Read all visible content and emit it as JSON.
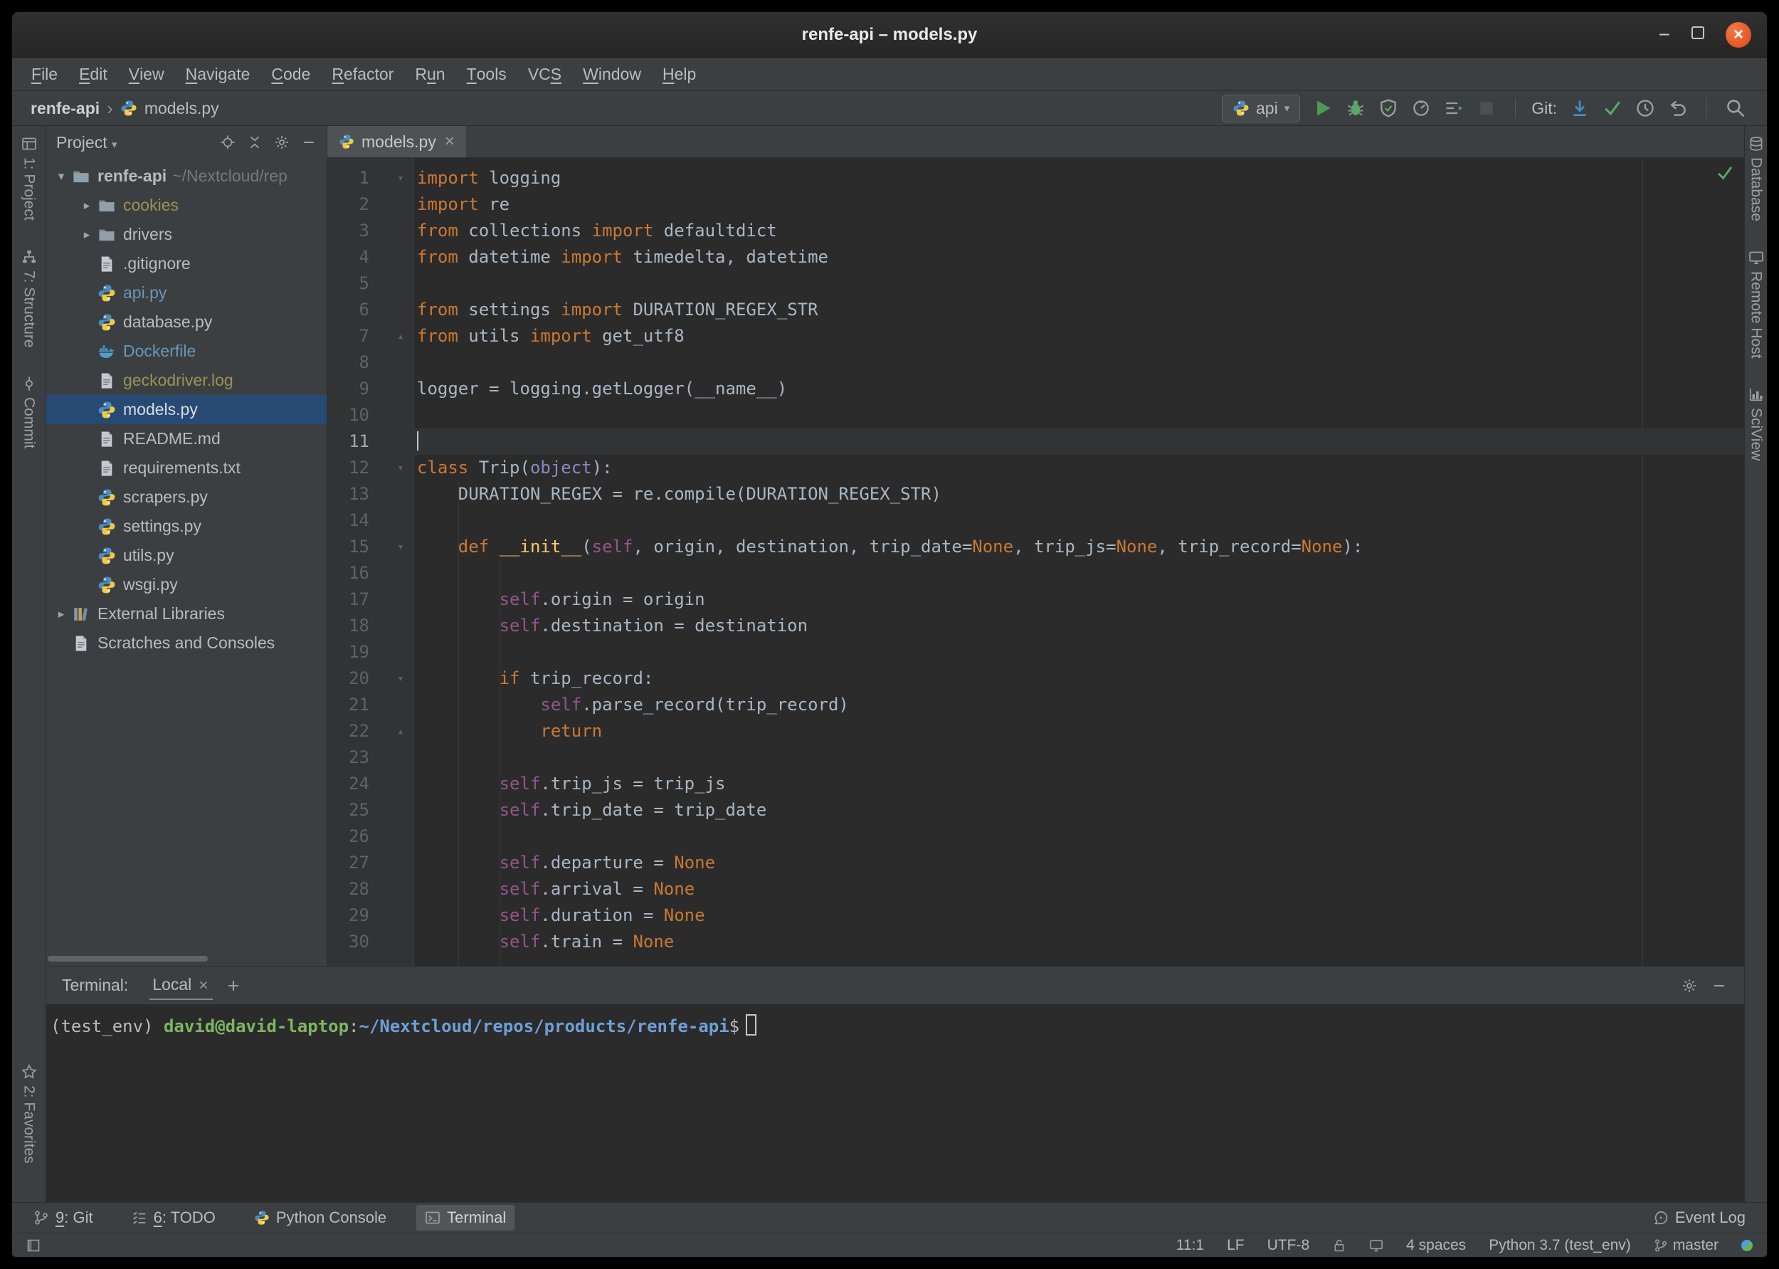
{
  "titlebar": {
    "title": "renfe-api – models.py"
  },
  "menubar": {
    "items": [
      {
        "label": "File",
        "mnemonic": 0
      },
      {
        "label": "Edit",
        "mnemonic": 0
      },
      {
        "label": "View",
        "mnemonic": 0
      },
      {
        "label": "Navigate",
        "mnemonic": 0
      },
      {
        "label": "Code",
        "mnemonic": 0
      },
      {
        "label": "Refactor",
        "mnemonic": 0
      },
      {
        "label": "Run",
        "mnemonic": 1
      },
      {
        "label": "Tools",
        "mnemonic": 0
      },
      {
        "label": "VCS",
        "mnemonic": 2
      },
      {
        "label": "Window",
        "mnemonic": 0
      },
      {
        "label": "Help",
        "mnemonic": 0
      }
    ]
  },
  "navbar": {
    "breadcrumbs": [
      {
        "label": "renfe-api",
        "bold": true
      },
      {
        "label": "models.py",
        "icon": "python"
      }
    ],
    "run_config": {
      "label": "api"
    },
    "run_buttons": [
      {
        "name": "run",
        "icon": "play"
      },
      {
        "name": "debug",
        "icon": "bug"
      },
      {
        "name": "run-with-coverage",
        "icon": "shield"
      },
      {
        "name": "profile",
        "icon": "profiler"
      },
      {
        "name": "concurrency-diagram",
        "icon": "concurrency"
      },
      {
        "name": "stop",
        "icon": "stop",
        "disabled": true
      }
    ],
    "git": {
      "label": "Git:",
      "buttons": [
        {
          "name": "update-project",
          "icon": "arrow-down"
        },
        {
          "name": "commit",
          "icon": "check"
        },
        {
          "name": "history",
          "icon": "clock"
        },
        {
          "name": "rollback",
          "icon": "undo"
        }
      ]
    }
  },
  "stripes": {
    "left_top": [
      {
        "label": "1: Project",
        "icon": "project"
      },
      {
        "label": "7: Structure",
        "icon": "structure"
      },
      {
        "label": "Commit",
        "icon": "commitnode"
      }
    ],
    "left_bottom": [
      {
        "label": "2: Favor<u></u>ites",
        "icon": "star",
        "plain": "2: Favorites"
      }
    ],
    "right": [
      {
        "label": "Database",
        "icon": "database"
      },
      {
        "label": "Remote Host",
        "icon": "remote"
      },
      {
        "label": "SciView",
        "icon": "sciview"
      }
    ]
  },
  "project_panel": {
    "header": "Project",
    "tree": [
      {
        "label": "renfe-api",
        "suffix": "~/Nextcloud/rep",
        "icon": "folder",
        "indent": 0,
        "chevron": "down",
        "bold": true
      },
      {
        "label": "cookies",
        "icon": "folder",
        "indent": 1,
        "chevron": "right",
        "color": "ignored"
      },
      {
        "label": "drivers",
        "icon": "folder",
        "indent": 1,
        "chevron": "right"
      },
      {
        "label": ".gitignore",
        "icon": "file",
        "indent": 1
      },
      {
        "label": "api.py",
        "icon": "python",
        "indent": 1,
        "color": "modified"
      },
      {
        "label": "database.py",
        "icon": "python",
        "indent": 1
      },
      {
        "label": "Dockerfile",
        "icon": "docker",
        "indent": 1,
        "color": "modified"
      },
      {
        "label": "geckodriver.log",
        "icon": "log",
        "indent": 1,
        "color": "ignored"
      },
      {
        "label": "models.py",
        "icon": "python",
        "indent": 1,
        "selected": true
      },
      {
        "label": "README.md",
        "icon": "markdown",
        "indent": 1
      },
      {
        "label": "requirements.txt",
        "icon": "text",
        "indent": 1
      },
      {
        "label": "scrapers.py",
        "icon": "python",
        "indent": 1
      },
      {
        "label": "settings.py",
        "icon": "python",
        "indent": 1
      },
      {
        "label": "utils.py",
        "icon": "python",
        "indent": 1
      },
      {
        "label": "wsgi.py",
        "icon": "python",
        "indent": 1
      },
      {
        "label": "External Libraries",
        "icon": "libraries",
        "indent": 0,
        "chevron": "right"
      },
      {
        "label": "Scratches and Consoles",
        "icon": "scratches",
        "indent": 0
      }
    ],
    "colors": {
      "ignored": "#9c9154",
      "modified": "#6897bb",
      "default": "#bbbbbb",
      "suffix": "#787878",
      "selected_bg": "#274a75",
      "selected_text": "#d8dde2"
    }
  },
  "editor": {
    "tab": {
      "label": "models.py"
    },
    "colors": {
      "kw": "#cc7832",
      "self": "#94558d",
      "fn": "#ffc66d",
      "bi": "#8888c6",
      "d": "#a9b7c6"
    },
    "lines": [
      {
        "n": 1,
        "fold": "down",
        "seg": [
          [
            "import",
            "kw"
          ],
          [
            " logging",
            "d"
          ]
        ]
      },
      {
        "n": 2,
        "seg": [
          [
            "import",
            "kw"
          ],
          [
            " re",
            "d"
          ]
        ]
      },
      {
        "n": 3,
        "seg": [
          [
            "from",
            "kw"
          ],
          [
            " collections ",
            "d"
          ],
          [
            "import",
            "kw"
          ],
          [
            " defaultdict",
            "d"
          ]
        ]
      },
      {
        "n": 4,
        "seg": [
          [
            "from",
            "kw"
          ],
          [
            " datetime ",
            "d"
          ],
          [
            "import",
            "kw"
          ],
          [
            " timedelta, datetime",
            "d"
          ]
        ]
      },
      {
        "n": 5,
        "seg": []
      },
      {
        "n": 6,
        "seg": [
          [
            "from",
            "kw"
          ],
          [
            " settings ",
            "d"
          ],
          [
            "import",
            "kw"
          ],
          [
            " DURATION_REGEX_STR",
            "d"
          ]
        ]
      },
      {
        "n": 7,
        "fold": "up",
        "seg": [
          [
            "from",
            "kw"
          ],
          [
            " utils ",
            "d"
          ],
          [
            "import",
            "kw"
          ],
          [
            " get_utf8",
            "d"
          ]
        ]
      },
      {
        "n": 8,
        "seg": []
      },
      {
        "n": 9,
        "seg": [
          [
            "logger = logging.getLogger(__name__)",
            "d"
          ]
        ]
      },
      {
        "n": 10,
        "seg": []
      },
      {
        "n": 11,
        "current": true,
        "seg": []
      },
      {
        "n": 12,
        "fold": "down",
        "seg": [
          [
            "class",
            "kw"
          ],
          [
            " Trip(",
            "d"
          ],
          [
            "object",
            "bi"
          ],
          [
            "):",
            "d"
          ]
        ]
      },
      {
        "n": 13,
        "seg": [
          [
            "    DURATION_REGEX = re.compile(DURATION_REGEX_STR)",
            "d"
          ]
        ]
      },
      {
        "n": 14,
        "seg": []
      },
      {
        "n": 15,
        "fold": "down",
        "seg": [
          [
            "    ",
            "d"
          ],
          [
            "def",
            "kw"
          ],
          [
            " ",
            "d"
          ],
          [
            "__init__",
            "fn"
          ],
          [
            "(",
            "d"
          ],
          [
            "self",
            "self"
          ],
          [
            ", origin, destination, trip_date=",
            "d"
          ],
          [
            "None",
            "kw"
          ],
          [
            ", trip_js=",
            "d"
          ],
          [
            "None",
            "kw"
          ],
          [
            ", trip_record=",
            "d"
          ],
          [
            "None",
            "kw"
          ],
          [
            "):",
            "d"
          ]
        ]
      },
      {
        "n": 16,
        "seg": []
      },
      {
        "n": 17,
        "seg": [
          [
            "        ",
            "d"
          ],
          [
            "self",
            "self"
          ],
          [
            ".origin = origin",
            "d"
          ]
        ]
      },
      {
        "n": 18,
        "seg": [
          [
            "        ",
            "d"
          ],
          [
            "self",
            "self"
          ],
          [
            ".destination = destination",
            "d"
          ]
        ]
      },
      {
        "n": 19,
        "seg": []
      },
      {
        "n": 20,
        "fold": "down",
        "seg": [
          [
            "        ",
            "d"
          ],
          [
            "if",
            "kw"
          ],
          [
            " trip_record:",
            "d"
          ]
        ]
      },
      {
        "n": 21,
        "seg": [
          [
            "            ",
            "d"
          ],
          [
            "self",
            "self"
          ],
          [
            ".parse_record(trip_record)",
            "d"
          ]
        ]
      },
      {
        "n": 22,
        "fold": "up",
        "seg": [
          [
            "            ",
            "d"
          ],
          [
            "return",
            "kw"
          ]
        ]
      },
      {
        "n": 23,
        "seg": []
      },
      {
        "n": 24,
        "seg": [
          [
            "        ",
            "d"
          ],
          [
            "self",
            "self"
          ],
          [
            ".trip_js = trip_js",
            "d"
          ]
        ]
      },
      {
        "n": 25,
        "seg": [
          [
            "        ",
            "d"
          ],
          [
            "self",
            "self"
          ],
          [
            ".trip_date = trip_date",
            "d"
          ]
        ]
      },
      {
        "n": 26,
        "seg": []
      },
      {
        "n": 27,
        "seg": [
          [
            "        ",
            "d"
          ],
          [
            "self",
            "self"
          ],
          [
            ".departure = ",
            "d"
          ],
          [
            "None",
            "kw"
          ]
        ]
      },
      {
        "n": 28,
        "seg": [
          [
            "        ",
            "d"
          ],
          [
            "self",
            "self"
          ],
          [
            ".arrival = ",
            "d"
          ],
          [
            "None",
            "kw"
          ]
        ]
      },
      {
        "n": 29,
        "seg": [
          [
            "        ",
            "d"
          ],
          [
            "self",
            "self"
          ],
          [
            ".duration = ",
            "d"
          ],
          [
            "None",
            "kw"
          ]
        ]
      },
      {
        "n": 30,
        "seg": [
          [
            "        ",
            "d"
          ],
          [
            "self",
            "self"
          ],
          [
            ".train = ",
            "d"
          ],
          [
            "None",
            "kw"
          ]
        ]
      }
    ]
  },
  "terminal": {
    "label": "Terminal:",
    "tab": {
      "label": "Local"
    },
    "prompt": [
      [
        "(test_env) ",
        "d"
      ],
      [
        "david@david-laptop",
        "user"
      ],
      [
        ":",
        "d"
      ],
      [
        "~/Nextcloud/repos/products/renfe-api",
        "path"
      ],
      [
        "$",
        "d"
      ]
    ],
    "colors": {
      "d": "#bbbbbb",
      "user": "#7cb662",
      "path": "#6f9fd8"
    }
  },
  "bottom_bar": {
    "buttons": [
      {
        "label": "9: Git",
        "icon": "branch",
        "mnemonic": 0
      },
      {
        "label": "6: TODO",
        "icon": "todo",
        "mnemonic": 0
      },
      {
        "label": "Python Console",
        "icon": "python"
      },
      {
        "label": "Terminal",
        "icon": "terminal",
        "active": true
      }
    ],
    "event_log": "Event Log"
  },
  "statusbar": {
    "caret": "11:1",
    "line_separator": "LF",
    "encoding": "UTF-8",
    "indent": "4 spaces",
    "interpreter": "Python 3.7 (test_env)",
    "branch": "master"
  }
}
